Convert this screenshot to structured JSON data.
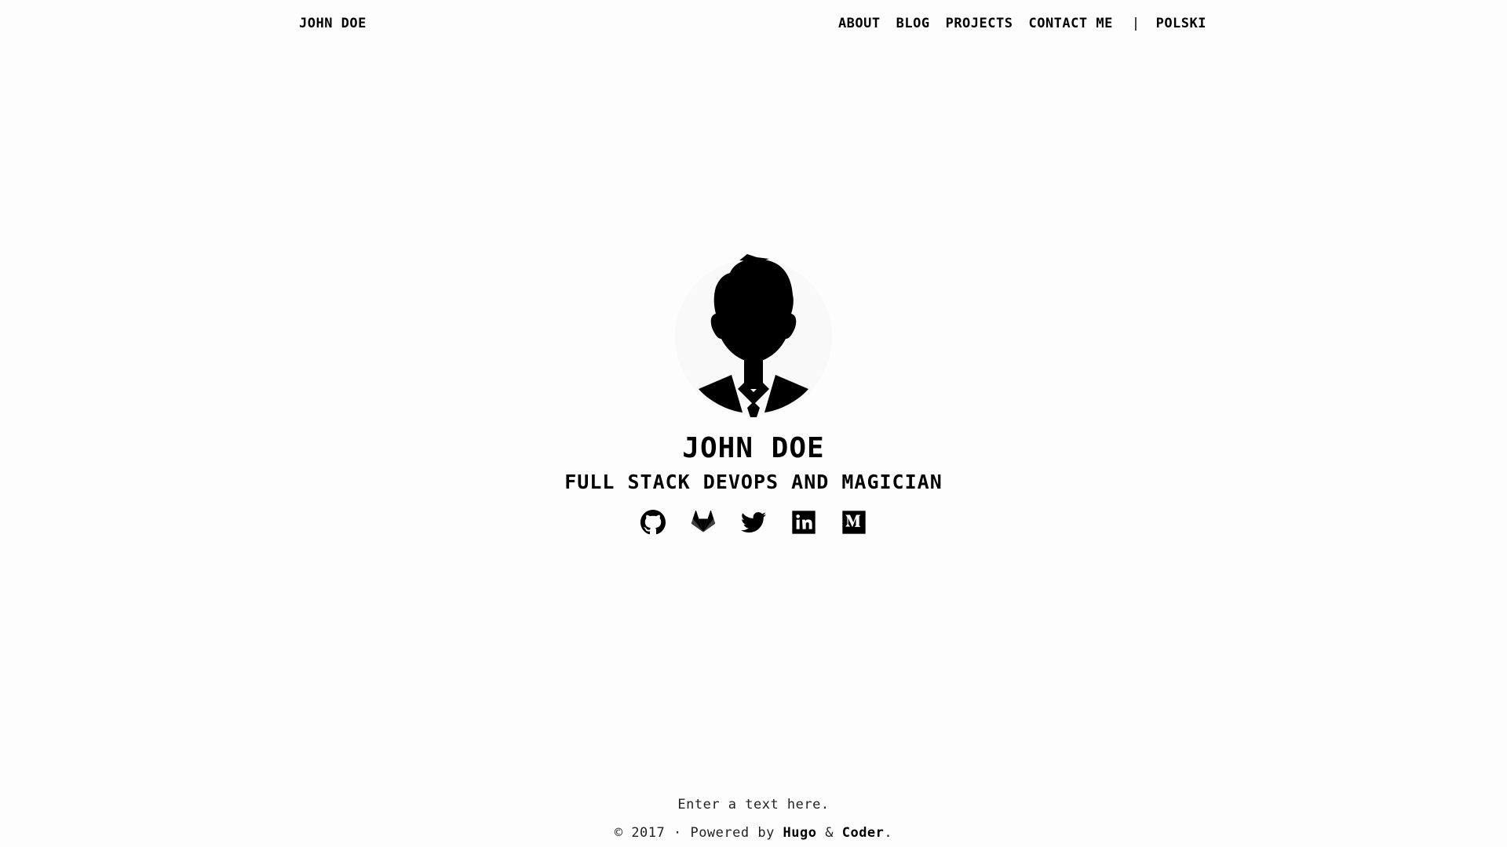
{
  "navbar": {
    "brand": "JOHN DOE",
    "links": [
      "ABOUT",
      "BLOG",
      "PROJECTS",
      "CONTACT ME"
    ],
    "separator": "|",
    "language": "POLSKI"
  },
  "hero": {
    "name": "JOHN DOE",
    "title": "FULL STACK DEVOPS AND MAGICIAN",
    "social_icons": [
      "github-icon",
      "gitlab-icon",
      "twitter-icon",
      "linkedin-icon",
      "medium-icon"
    ]
  },
  "footer": {
    "text": "Enter a text here.",
    "copyright_prefix": "© 2017 · Powered by ",
    "hugo_link": "Hugo",
    "amp": " & ",
    "coder_link": "Coder",
    "period": "."
  }
}
